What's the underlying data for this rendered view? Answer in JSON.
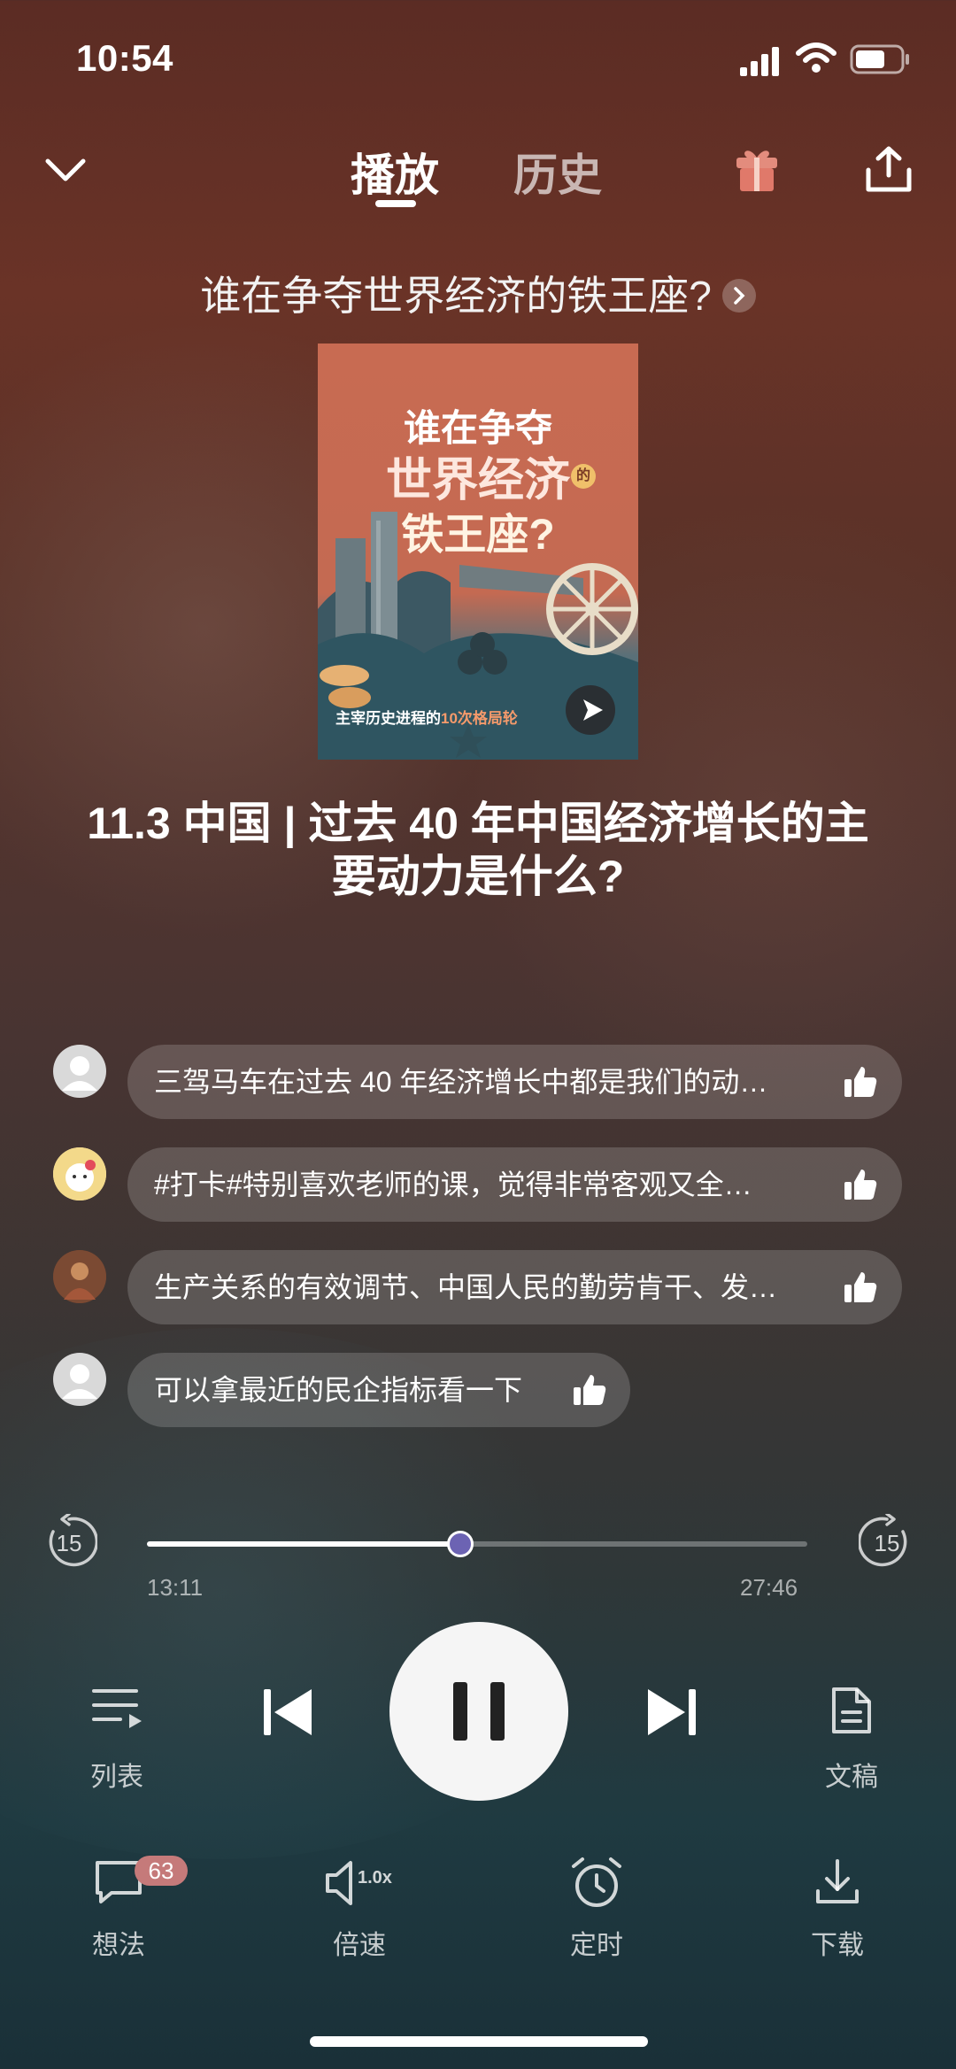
{
  "status_bar": {
    "time": "10:54"
  },
  "header": {
    "tabs": [
      {
        "label": "播放",
        "active": true
      },
      {
        "label": "历史",
        "active": false
      }
    ]
  },
  "book": {
    "link_title": "谁在争夺世界经济的铁王座?",
    "cover": {
      "line1": "谁在争夺",
      "line2": "世界经济",
      "line3": "铁王座?",
      "small": "的",
      "subtitle_a": "主宰历史进程的",
      "subtitle_b": "10次格局轮"
    }
  },
  "episode_title": "11.3 中国 | 过去 40 年中国经济增长的主要动力是什么?",
  "comments": [
    {
      "text": "三驾马车在过去 40 年经济增长中都是我们的动…"
    },
    {
      "text": "#打卡#特别喜欢老师的课，觉得非常客观又全…"
    },
    {
      "text": "生产关系的有效调节、中国人民的勤劳肯干、发…"
    },
    {
      "text": "可以拿最近的民企指标看一下"
    }
  ],
  "player": {
    "elapsed": "13:11",
    "duration": "27:46",
    "progress": 0.475,
    "skip_back": "15",
    "skip_forward": "15",
    "speed_icon_text": "1.0x"
  },
  "controls": {
    "playlist_label": "列表",
    "transcript_label": "文稿"
  },
  "bottom_bar": {
    "thoughts_label": "想法",
    "thoughts_count": "63",
    "speed_label": "倍速",
    "timer_label": "定时",
    "download_label": "下载"
  },
  "colors": {
    "knob": "#6c63b3",
    "badge": "#c57a7a",
    "gift": "#e0796a"
  }
}
